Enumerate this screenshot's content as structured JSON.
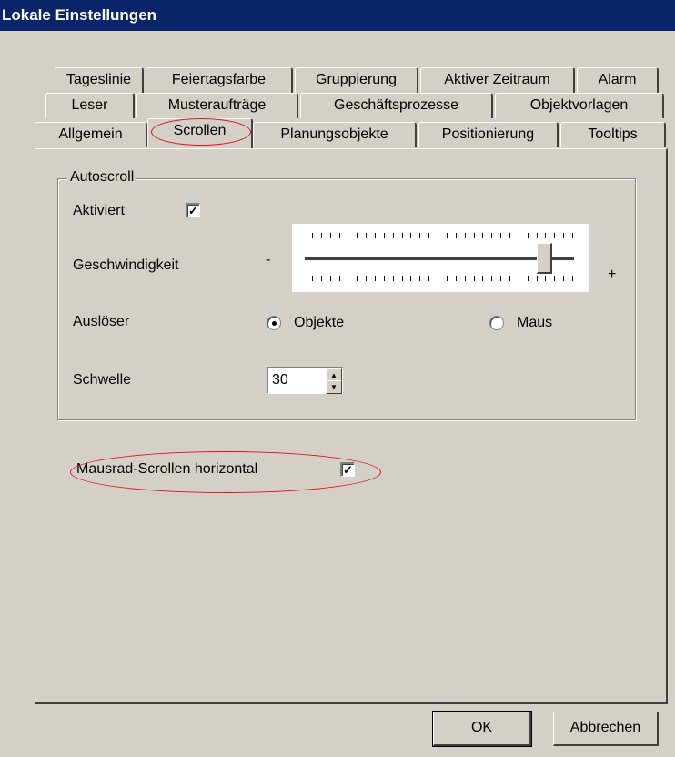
{
  "window": {
    "title": "Lokale Einstellungen"
  },
  "tabs": {
    "row1": [
      "Tageslinie",
      "Feiertagsfarbe",
      "Gruppierung",
      "Aktiver Zeitraum",
      "Alarm"
    ],
    "row2": [
      "Leser",
      "Musteraufträge",
      "Geschäftsprozesse",
      "Objektvorlagen"
    ],
    "row3": [
      "Allgemein",
      "Scrollen",
      "Planungsobjekte",
      "Positionierung",
      "Tooltips"
    ],
    "selected": "Scrollen"
  },
  "autoscroll": {
    "group_label": "Autoscroll",
    "activated_label": "Aktiviert",
    "activated_checked": true,
    "speed_label": "Geschwindigkeit",
    "speed_minus": "-",
    "speed_plus": "+",
    "speed_value_fraction": 0.89,
    "trigger_label": "Auslöser",
    "trigger_options": [
      "Objekte",
      "Maus"
    ],
    "trigger_selected": "Objekte",
    "threshold_label": "Schwelle",
    "threshold_value": "30"
  },
  "mousewheel": {
    "label": "Mausrad-Scrollen horizontal",
    "checked": true
  },
  "buttons": {
    "ok": "OK",
    "cancel": "Abbrechen"
  },
  "colors": {
    "titlebar": "#0a246a",
    "annotation": "#e0101a",
    "face": "#d4d0c8"
  }
}
